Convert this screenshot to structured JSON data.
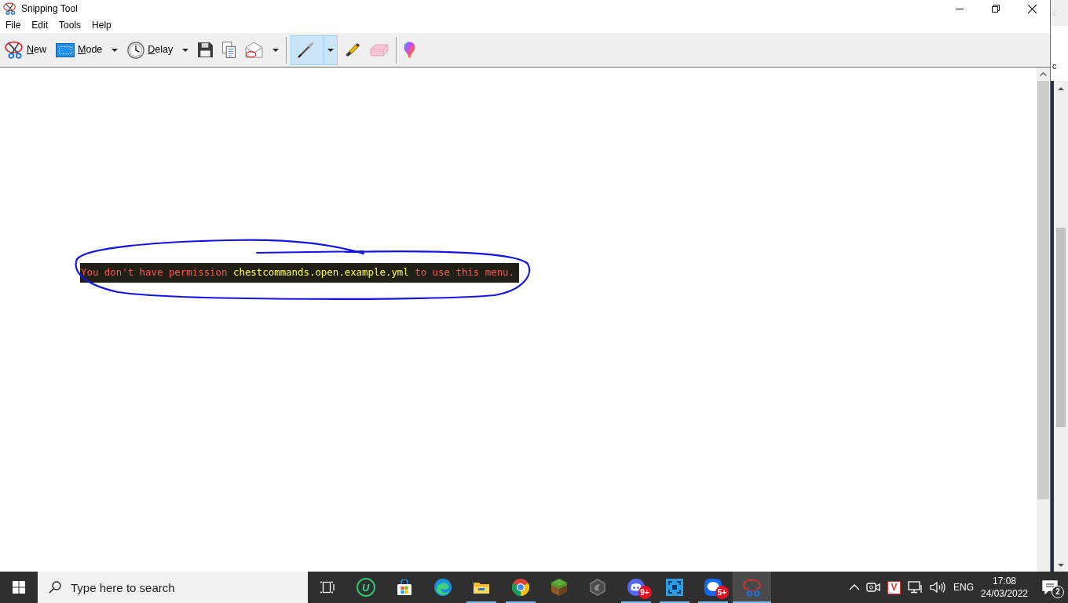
{
  "window": {
    "title": "Snipping Tool"
  },
  "menu": [
    "File",
    "Edit",
    "Tools",
    "Help"
  ],
  "toolbar": [
    {
      "kind": "new",
      "label": "New"
    },
    {
      "kind": "mode",
      "label": "Mode",
      "dropdown": true
    },
    {
      "kind": "delay",
      "label": "Delay",
      "dropdown": true
    },
    {
      "kind": "save"
    },
    {
      "kind": "copy"
    },
    {
      "kind": "send",
      "dropdown": true
    },
    {
      "kind": "separator"
    },
    {
      "kind": "pen",
      "dropdown": true,
      "selected": true
    },
    {
      "kind": "highlighter",
      "selected": false
    },
    {
      "kind": "eraser",
      "selected": false
    },
    {
      "kind": "separator"
    },
    {
      "kind": "paint"
    }
  ],
  "snip": {
    "segments": [
      {
        "text": "You don't have permission ",
        "color": "#ff5555"
      },
      {
        "text": "chestcommands.open.example.yml",
        "color": "#ffff55"
      },
      {
        "text": " to use this menu.",
        "color": "#ff5555"
      }
    ]
  },
  "background_window": {
    "text": "c"
  },
  "taskbar": {
    "search": {
      "placeholder": "Type here to search"
    },
    "apps": [
      {
        "kind": "task-view",
        "running": false,
        "selected": false
      },
      {
        "kind": "letter",
        "letter": "U",
        "running": false,
        "selected": false
      },
      {
        "kind": "store",
        "running": false,
        "selected": false
      },
      {
        "kind": "edge",
        "running": false,
        "selected": false
      },
      {
        "kind": "explorer",
        "running": true,
        "selected": false
      },
      {
        "kind": "chrome",
        "running": true,
        "selected": false
      },
      {
        "kind": "minecraft",
        "running": false,
        "selected": false
      },
      {
        "kind": "gray-app",
        "running": false,
        "selected": false
      },
      {
        "kind": "discord",
        "running": true,
        "selected": false,
        "badge": "9+"
      },
      {
        "kind": "blue-app",
        "running": true,
        "selected": false
      },
      {
        "kind": "zalo",
        "running": true,
        "selected": false,
        "badge": "5+"
      },
      {
        "kind": "snipping",
        "running": true,
        "selected": true
      }
    ],
    "tray": {
      "app_letter": "V",
      "language": "ENG",
      "time": "17:08",
      "date": "24/03/2022",
      "notifications": "2"
    }
  }
}
